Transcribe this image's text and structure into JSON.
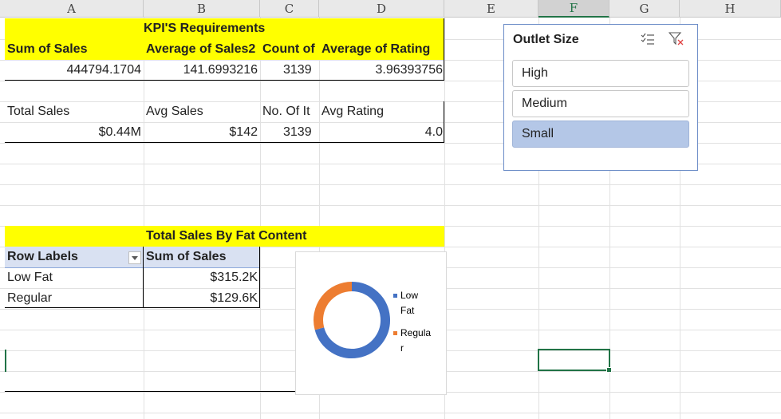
{
  "columns": [
    "A",
    "B",
    "C",
    "D",
    "E",
    "F",
    "G",
    "H"
  ],
  "kpi": {
    "title": "KPI'S Requirements",
    "headers": [
      "Sum of Sales",
      "Average of Sales2",
      "Count of",
      "Average of Rating"
    ],
    "values": [
      "444794.1704",
      "141.6993216",
      "3139",
      "3.96393756"
    ],
    "labels": [
      "Total Sales",
      "Avg Sales",
      "No. Of It",
      "Avg Rating"
    ],
    "formatted": [
      "$0.44M",
      "$142",
      "3139",
      "4.0"
    ]
  },
  "fat": {
    "title": "Total Sales By Fat Content",
    "row_labels_header": "Row Labels",
    "sum_header": "Sum of Sales",
    "rows": [
      {
        "label": "Low Fat",
        "value": "$315.2K"
      },
      {
        "label": "Regular",
        "value": "$129.6K"
      }
    ]
  },
  "slicer": {
    "title": "Outlet Size",
    "items": [
      "High",
      "Medium",
      "Small"
    ],
    "selected": "Small",
    "icons": [
      "multi-select-icon",
      "clear-filter-icon"
    ]
  },
  "chart_data": {
    "type": "pie",
    "categories": [
      "Low Fat",
      "Regular"
    ],
    "values": [
      315.2,
      129.6
    ],
    "unit": "K",
    "legend_position": "right",
    "legend_labels": [
      "Low",
      "Fat",
      "Regula",
      "r"
    ],
    "colors": [
      "#4472c4",
      "#ed7d31"
    ],
    "title": ""
  },
  "colors": {
    "yellow": "#ffff00",
    "header_blue": "#d9e1f2",
    "slicer_selected": "#b4c7e7",
    "excel_green": "#217346"
  }
}
